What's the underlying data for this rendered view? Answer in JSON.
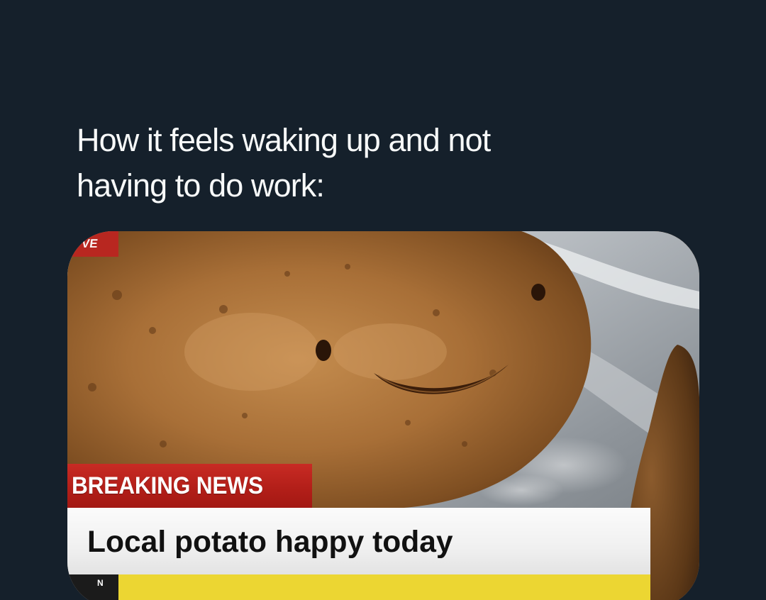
{
  "tweet": {
    "text": "How it feels waking up and not\nhaving to do work:"
  },
  "media": {
    "live_tag": "VE",
    "breaking_label": "BREAKING NEWS",
    "headline": "Local potato happy today",
    "ticker_label": "N"
  },
  "colors": {
    "background": "#15202b",
    "text": "#f7f9f9",
    "breaking_red": "#b31f19",
    "ticker_yellow": "#ecd632"
  }
}
